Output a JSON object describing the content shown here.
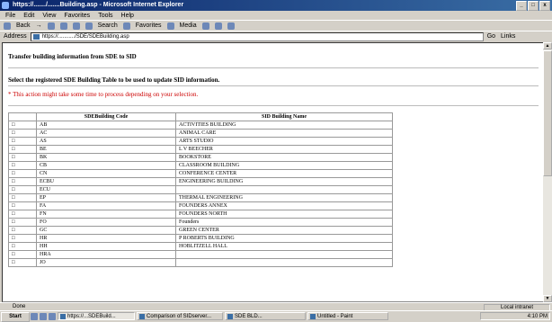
{
  "window": {
    "title": "https://......./.......Building.asp - Microsoft Internet Explorer",
    "min": "_",
    "max": "□",
    "close": "x"
  },
  "menu": [
    "File",
    "Edit",
    "View",
    "Favorites",
    "Tools",
    "Help"
  ],
  "toolbar": {
    "back": "Back",
    "forward": "→",
    "search": "Search",
    "favorites": "Favorites",
    "media": "Media"
  },
  "address": {
    "label": "Address",
    "url": "https://.........../SDE/SDEBuilding.asp",
    "go": "Go",
    "links": "Links"
  },
  "page": {
    "title": "Transfer building information from SDE to SID",
    "instruction": "Select the registered SDE Building Table to be used to update SID information.",
    "warning": "* This action might take some time to process depending on your selection."
  },
  "table": {
    "headers": [
      "",
      "SDEBuilding Code",
      "SID Building Name"
    ],
    "rows": [
      [
        "□",
        "AB",
        "ACTIVITIES BUILDING"
      ],
      [
        "□",
        "AC",
        "ANIMAL CARE"
      ],
      [
        "□",
        "AS",
        "ARTS STUDIO"
      ],
      [
        "□",
        "BE",
        "L V BEECHER"
      ],
      [
        "□",
        "BK",
        "BOOKSTORE"
      ],
      [
        "□",
        "CB",
        "CLASSROOM BUILDING"
      ],
      [
        "□",
        "CN",
        "CONFERENCE CENTER"
      ],
      [
        "□",
        "ECBU",
        "ENGINEERING BUILDING"
      ],
      [
        "□",
        "ECU",
        ""
      ],
      [
        "□",
        "EP",
        "THERMAL ENGINEERING"
      ],
      [
        "□",
        "FA",
        "FOUNDERS ANNEX"
      ],
      [
        "□",
        "FN",
        "FOUNDERS NORTH"
      ],
      [
        "□",
        "FO",
        "Founders"
      ],
      [
        "□",
        "GC",
        "GREEN CENTER"
      ],
      [
        "□",
        "HR",
        "P ROBERTS BUILDING"
      ],
      [
        "□",
        "HH",
        "HOBLITZELL HALL"
      ],
      [
        "□",
        "HRA",
        ""
      ],
      [
        "□",
        "JO",
        ""
      ]
    ]
  },
  "status": {
    "text": "Done",
    "zone": "Local intranet"
  },
  "taskbar": {
    "start": "Start",
    "tasks": [
      "https://...SDEBuild...",
      "Comparison of SIDserver...",
      "SDE BLD...",
      "Untitled - Paint"
    ],
    "clock": "4:10 PM"
  }
}
